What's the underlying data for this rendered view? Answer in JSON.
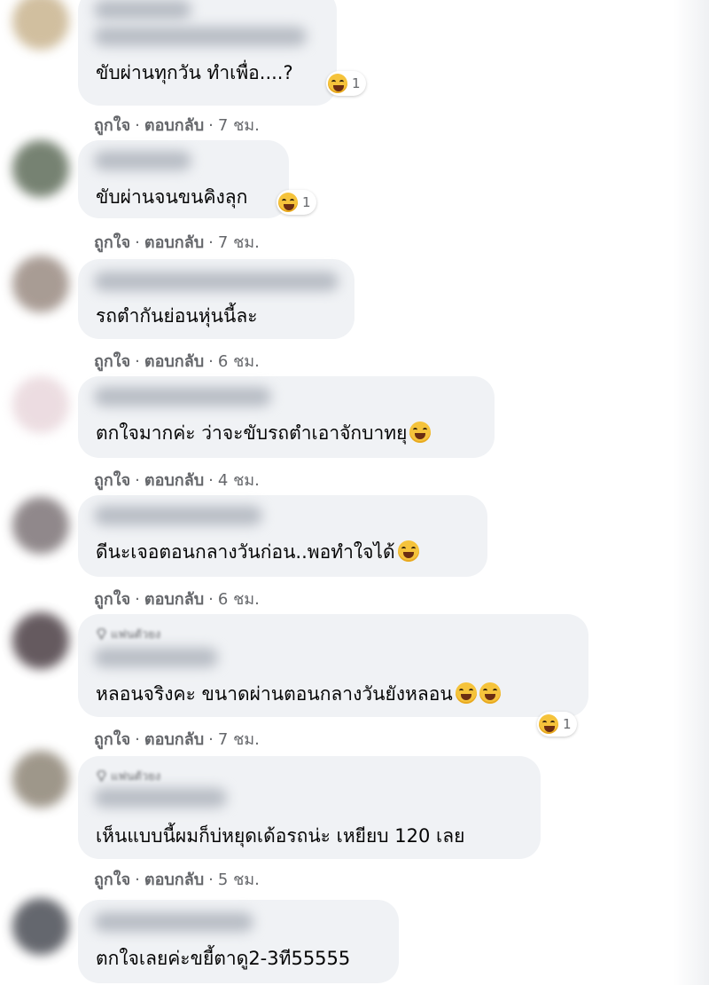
{
  "actions": {
    "like": "ถูกใจ",
    "reply": "ตอบกลับ",
    "dot": "·"
  },
  "badge_label": "แฟนตัวยง",
  "comments": [
    {
      "text": "ขับผ่านทุกวัน ทำเพื่อ....?",
      "time": "7 ชม.",
      "reaction_count": "1"
    },
    {
      "text": "ขับผ่านจนขนคิงลุก",
      "time": "7 ชม.",
      "reaction_count": "1"
    },
    {
      "text": "รถตำกันย่อนหุ่นนี้ละ",
      "time": "6 ชม."
    },
    {
      "text": "ตกใจมากค่ะ ว่าจะขับรถตำเอาจักบาทยุ",
      "time": "4 ชม."
    },
    {
      "text": "ดีนะเจอตอนกลางวันก่อน..พอทำใจได้",
      "time": "6 ชม."
    },
    {
      "text": "หลอนจริงคะ ขนาดผ่านตอนกลางวันยังหลอน",
      "time": "7 ชม.",
      "reaction_count": "1"
    },
    {
      "text": "เห็นแบบนี้ผมก็บ่หยุดเด้อรถน่ะ เหยียบ 120 เลย",
      "time": "5 ชม."
    },
    {
      "text": "ตกใจเลยค่ะขยี้ตาดู2-3ที55555"
    }
  ],
  "colors": {
    "bubble": "#f0f2f5",
    "meta": "#65676b",
    "text": "#050505",
    "emoji": "#f5c33b"
  },
  "icons": {
    "reaction": "grinning-squinting-face-icon",
    "laugh": "rolling-on-floor-laughing-icon",
    "badge": "diamond-icon"
  }
}
